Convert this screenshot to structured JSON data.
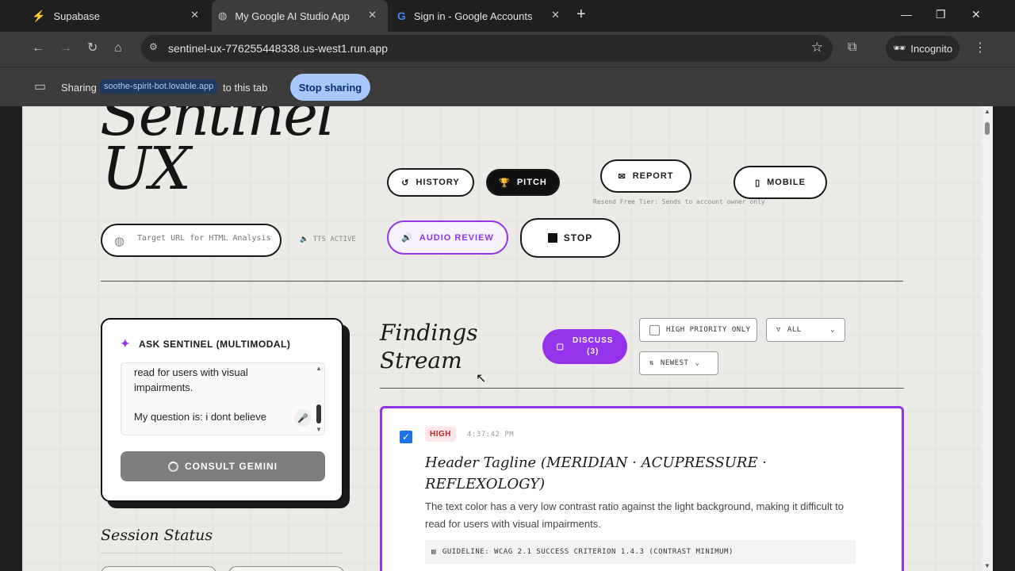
{
  "browser": {
    "tabs": [
      {
        "title": "Supabase",
        "icon": "supabase-icon"
      },
      {
        "title": "My Google AI Studio App",
        "icon": "globe-icon"
      },
      {
        "title": "Sign in - Google Accounts",
        "icon": "google-icon"
      }
    ],
    "url": "sentinel-ux-776255448338.us-west1.run.app",
    "incognito_label": "Incognito",
    "share": {
      "prefix": "Sharing",
      "domain": "soothe-spirit-bot.lovable.app",
      "suffix": "to this tab",
      "stop_label": "Stop sharing"
    }
  },
  "app": {
    "title_line1": "Sentinel",
    "title_line2": "UX",
    "buttons": {
      "history": "HISTORY",
      "pitch": "PITCH",
      "report": "REPORT",
      "mobile": "MOBILE",
      "audio_review": "AUDIO REVIEW",
      "stop": "STOP"
    },
    "report_note": "Resend Free Tier: Sends to account owner only",
    "url_placeholder": "Target URL for HTML Analysis",
    "tts_status": "TTS ACTIVE",
    "ask": {
      "title": "ASK SENTINEL (MULTIMODAL)",
      "textarea_text": "read for users with visual impairments.",
      "question_text": "My question is: i dont believe",
      "consult_label": "CONSULT GEMINI"
    },
    "session_status_title": "Session Status",
    "findings": {
      "title_line1": "Findings",
      "title_line2": "Stream",
      "discuss_label": "DISCUSS",
      "discuss_count": "(3)",
      "high_priority_label": "HIGH PRIORITY ONLY",
      "filter_value": "ALL",
      "sort_value": "NEWEST"
    },
    "finding": {
      "severity": "HIGH",
      "time": "4:37:42 PM",
      "title": "Header Tagline (MERIDIAN · ACUPRESSURE · REFLEXOLOGY)",
      "description": "The text color has a very low contrast ratio against the light background, making it difficult to read for users with visual impairments.",
      "guideline": "GUIDELINE: WCAG 2.1 SUCCESS CRITERION 1.4.3 (CONTRAST MINIMUM)"
    }
  },
  "colors": {
    "accent": "#9333ea",
    "high_badge": "#c0262d",
    "chrome_bg": "#1f1f1f"
  }
}
